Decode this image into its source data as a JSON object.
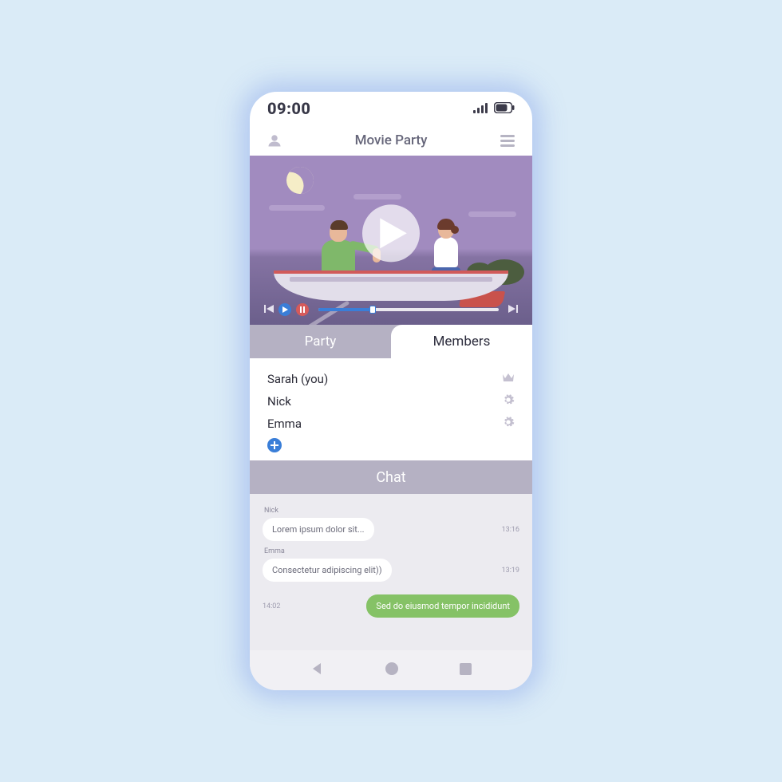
{
  "status": {
    "time": "09:00"
  },
  "header": {
    "title": "Movie Party"
  },
  "tabs": {
    "party": "Party",
    "members": "Members"
  },
  "members": [
    {
      "name": "Sarah (you)",
      "role": "crown"
    },
    {
      "name": "Nick",
      "role": "gear"
    },
    {
      "name": "Emma",
      "role": "gear"
    }
  ],
  "chat": {
    "header": "Chat",
    "messages": [
      {
        "sender": "Nick",
        "text": "Lorem ipsum dolor sit...",
        "time": "13:16",
        "outgoing": false
      },
      {
        "sender": "Emma",
        "text": "Consectetur adipiscing elit))",
        "time": "13:19",
        "outgoing": false
      },
      {
        "sender": "",
        "text": "Sed do eiusmod tempor incididunt",
        "time": "14:02",
        "outgoing": true
      }
    ]
  }
}
